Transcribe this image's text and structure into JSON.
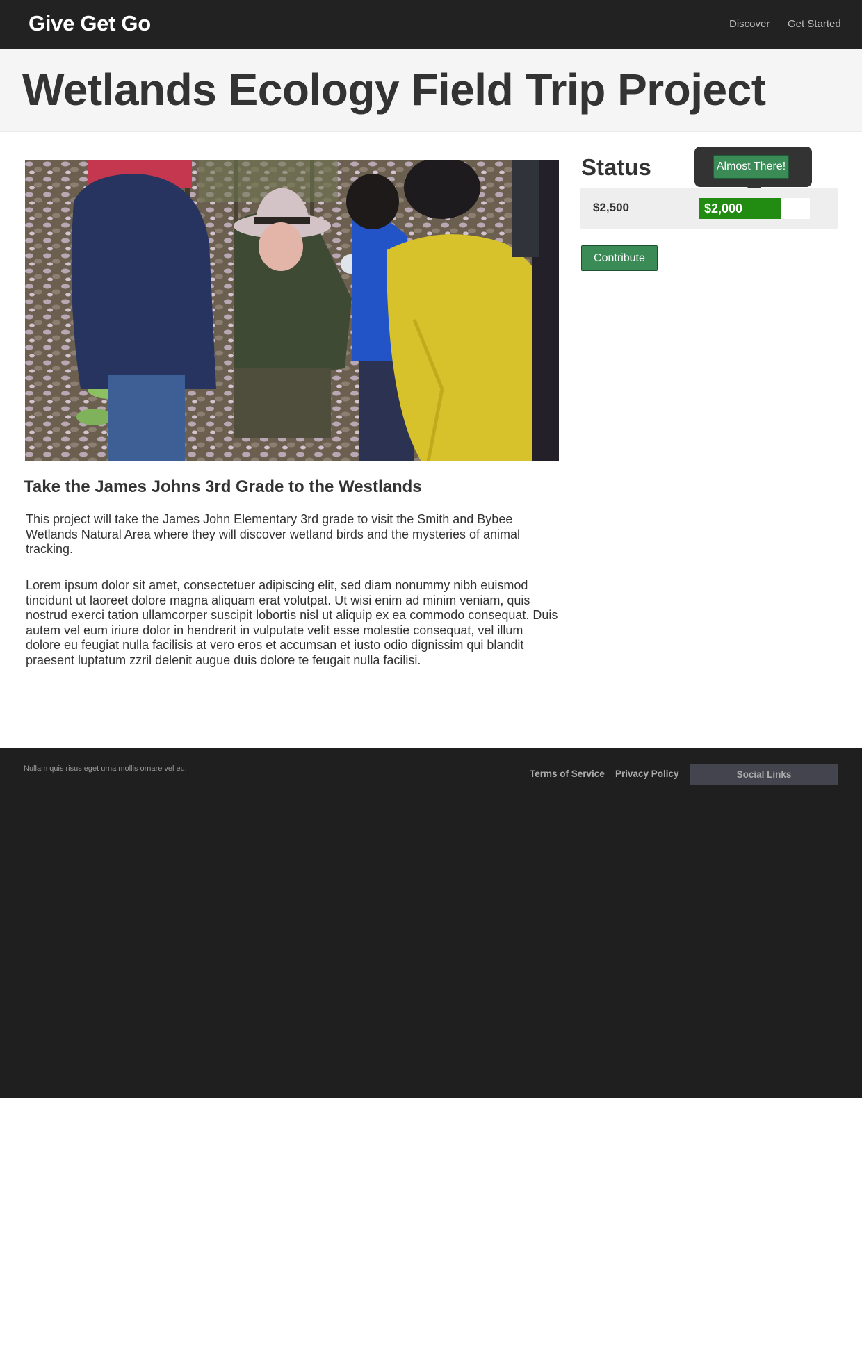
{
  "nav": {
    "brand": "Give Get Go",
    "links": [
      "Discover",
      "Get Started"
    ]
  },
  "hero": {
    "title": "Wetlands Ecology Field Trip Project"
  },
  "project": {
    "subtitle": "Take the James Johns 3rd Grade to the Westlands",
    "paragraphs": [
      "This project will take the James John Elementary 3rd grade to visit the Smith and Bybee Wetlands Natural Area where they will discover wetland birds and the mysteries of animal tracking.",
      "Lorem ipsum dolor sit amet, consectetuer adipiscing elit, sed diam nonummy nibh euismod tincidunt ut laoreet dolore magna aliquam erat volutpat. Ut wisi enim ad minim veniam, quis nostrud exerci tation ullamcorper suscipit lobortis nisl ut aliquip ex ea commodo consequat. Duis autem vel eum iriure dolor in hendrerit in vulputate velit esse molestie consequat, vel illum dolore eu feugiat nulla facilisis at vero eros et accumsan et iusto odio dignissim qui blandit praesent luptatum zzril delenit augue duis dolore te feugait nulla facilisi."
    ]
  },
  "status": {
    "title": "Status",
    "tooltip": "Almost There!",
    "goal": "$2,500",
    "raised": "$2,000",
    "progress_fraction": 0.74,
    "contribute_label": "Contribute"
  },
  "footer": {
    "note": "Nullam quis risus eget urna mollis ornare vel eu.",
    "links": [
      "Terms of Service",
      "Privacy Policy"
    ],
    "social_label": "Social Links"
  },
  "colors": {
    "navbar": "#222222",
    "accent_green": "#3b8b57",
    "progress_green": "#228b11",
    "footer": "#1f1f1f"
  }
}
